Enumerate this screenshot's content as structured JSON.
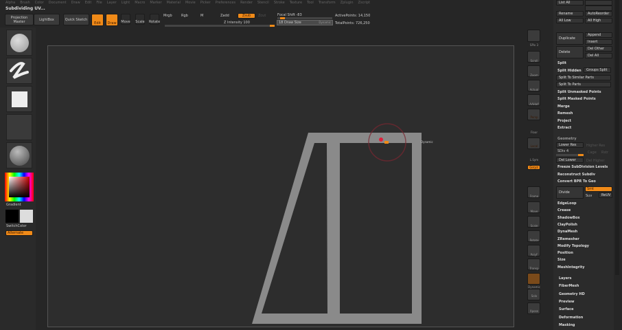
{
  "menu": [
    "Alpha",
    "Brush",
    "Color",
    "Document",
    "Draw",
    "Edit",
    "File",
    "Layer",
    "Light",
    "Macro",
    "Marker",
    "Material",
    "Movie",
    "Picker",
    "Preferences",
    "Render",
    "Stencil",
    "Stroke",
    "Texture",
    "Tool",
    "Transform",
    "Zplugin",
    "Zscript"
  ],
  "title": "Subdividing UV...",
  "toolbar": {
    "projection_master": "Projection Master",
    "lightbox": "LightBox",
    "quick_sketch": "Quick Sketch",
    "edit": "Edit",
    "draw": "Draw",
    "move": "Move",
    "scale": "Scale",
    "rotate": "Rotate",
    "mrgb": "Mrgb",
    "rgb": "Rgb",
    "m": "M",
    "zadd": "Zadd",
    "zsub": "Zsub",
    "zcut": "Zcut",
    "z_intensity": "Z Intensity 100",
    "focal_shift": "Focal Shift -83",
    "draw_size": "Draw Size",
    "draw_size_value": "18",
    "dynamic": "Dynamic",
    "active_points": "ActivePoints: 14,150",
    "total_points": "TotalPoints: 726,250"
  },
  "left": {
    "gradient": "Gradient",
    "switch_color": "SwitchColor",
    "alternate": "Alternate"
  },
  "shelf": {
    "spix": "SPix 3",
    "scroll": "Scroll",
    "zoom": "Zoom",
    "actual": "Actual",
    "aahalf": "AAHalf",
    "persp": "Persp",
    "floor": "Floor",
    "local": "Local",
    "lsym": "L.Sym",
    "xyz": "Gxyz",
    "frame": "Frame",
    "move": "Move",
    "scale": "Scale",
    "rotate": "Rotate",
    "polyf": "PolyF",
    "transp": "Transp",
    "dynamic": "Dynamic",
    "solo": "Solo",
    "xpose": "Xpose"
  },
  "right": {
    "list_all": "List All",
    "rename": "Rename",
    "autoreorder": "AutoReorder",
    "all_low": "All Low",
    "all_high": "All High",
    "duplicate": "Duplicate",
    "append": "Append",
    "insert": "Insert",
    "delete": "Delete",
    "del_other": "Del Other",
    "del_all": "Del All",
    "split": "Split",
    "split_hidden": "Split Hidden",
    "groups_split": "Groups Split",
    "split_unmasked": "Split To Similar Parts",
    "split_to_parts": "Split To Parts",
    "split_masked": "Split Unmasked Points",
    "split_masked2": "Split Masked Points",
    "merge": "Merge",
    "remesh": "Remesh",
    "project": "Project",
    "extract": "Extract",
    "geometry": "Geometry",
    "lower_res": "Lower Res",
    "higher_res": "Higher Res",
    "sdiv": "SDiv 4",
    "cage": "Cage",
    "rstr": "Rstr",
    "del_lower": "Del Lower",
    "del_higher": "Del Higher",
    "freeze": "Freeze SubDivision Levels",
    "reconstruct": "Reconstruct Subdiv",
    "convert": "Convert BPR To Geo",
    "divide": "Divide",
    "smt": "Smt",
    "suv": "Suv",
    "reluv": "ReUV",
    "subs": [
      "EdgeLoop",
      "Crease",
      "ShadowBox",
      "ClayPolish",
      "DynaMesh",
      "ZRemesher",
      "Modify Topology",
      "Position",
      "Size",
      "MeshIntegrity"
    ],
    "sections": [
      "Layers",
      "FiberMesh",
      "Geometry HD",
      "Preview",
      "Surface",
      "Deformation",
      "Masking"
    ]
  },
  "viewport": {
    "cursor_label": "Dynamic",
    "accent": "#f08a18",
    "model_color": "#8a8a8a"
  }
}
